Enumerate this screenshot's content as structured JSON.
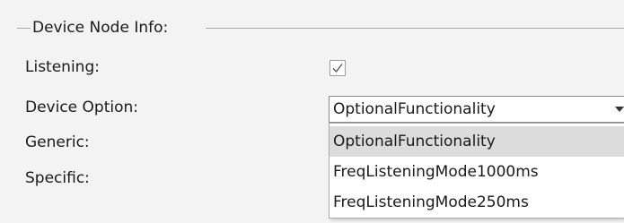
{
  "group": {
    "title": "Device Node Info:"
  },
  "fields": {
    "listening_label": "Listening:",
    "listening_checked": true,
    "device_option_label": "Device Option:",
    "generic_label": "Generic:",
    "specific_label": "Specific:"
  },
  "device_option": {
    "selected_value": "OptionalFunctionality",
    "options": [
      "OptionalFunctionality",
      "FreqListeningMode1000ms",
      "FreqListeningMode250ms"
    ],
    "highlighted_option": "OptionalFunctionality"
  },
  "icons": {
    "checkmark": "checkmark-icon",
    "dropdown_arrow": "chevron-down-icon"
  },
  "colors": {
    "background": "#f3f3f3",
    "highlight": "#dcdcdc",
    "check": "#555555"
  }
}
